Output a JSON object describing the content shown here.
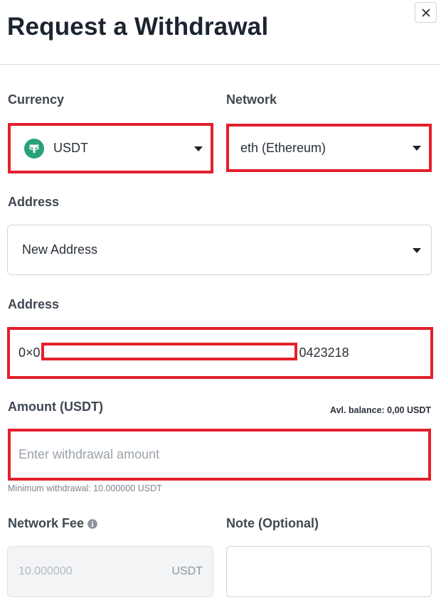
{
  "dialog": {
    "title": "Request a Withdrawal",
    "close_icon": "close-icon"
  },
  "currency": {
    "label": "Currency",
    "value": "USDT",
    "icon": "tether-icon",
    "icon_color": "#26a17b"
  },
  "network": {
    "label": "Network",
    "value": "eth (Ethereum)"
  },
  "address_select": {
    "label": "Address",
    "value": "New Address"
  },
  "address_input": {
    "label": "Address",
    "value_prefix": "0×0",
    "value_suffix": "0423218"
  },
  "amount": {
    "label": "Amount (USDT)",
    "balance": "Avl. balance: 0,00 USDT",
    "placeholder": "Enter withdrawal amount",
    "minimum_hint": "Minimum withdrawal: 10.000000 USDT"
  },
  "network_fee": {
    "label": "Network Fee",
    "info_icon": "info-icon",
    "value": "10.000000",
    "unit": "USDT"
  },
  "note": {
    "label": "Note (Optional)",
    "value": ""
  },
  "colors": {
    "highlight": "#e3202c",
    "tether": "#26a17b"
  }
}
